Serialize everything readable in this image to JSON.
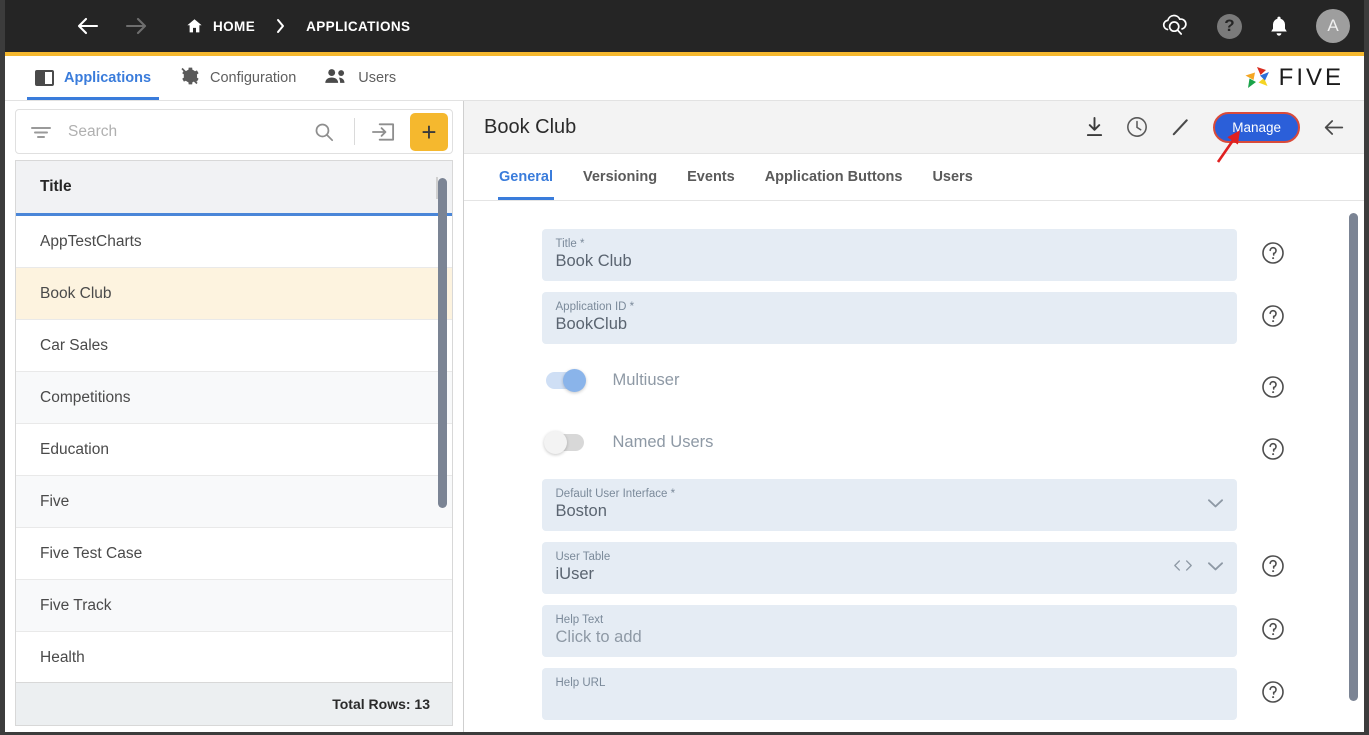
{
  "topbar": {
    "menu_icon": "hamburger-icon",
    "back_icon": "arrow-left-icon",
    "forward_icon": "arrow-right-icon",
    "home_icon": "home-icon",
    "breadcrumb": [
      "HOME",
      "APPLICATIONS"
    ],
    "separator": "chevron-right-icon",
    "right_icons": [
      "cloud-search-icon",
      "help-icon",
      "notifications-bell-icon"
    ],
    "avatar_initial": "A",
    "accent_strip_color": "#f5b82e",
    "background_color": "#252525"
  },
  "subnav": {
    "items": [
      {
        "label": "Applications",
        "icon": "applications-icon",
        "active": true
      },
      {
        "label": "Configuration",
        "icon": "configuration-gear-icon",
        "active": false
      },
      {
        "label": "Users",
        "icon": "users-icon",
        "active": false
      }
    ],
    "logo_text": "FIVE",
    "active_color": "#3a7cdb"
  },
  "sidebar": {
    "search": {
      "placeholder": "Search",
      "value": "",
      "filter_icon": "filter-icon",
      "search_icon": "search-icon",
      "import_icon": "import-icon",
      "add_label": "+",
      "add_color": "#f5b82e"
    },
    "grid": {
      "column_header": "Title",
      "rows": [
        "AppTestCharts",
        "Book Club",
        "Car Sales",
        "Competitions",
        "Education",
        "Five",
        "Five Test Case",
        "Five Track",
        "Health"
      ],
      "selected_row": "Book Club",
      "selected_color": "#fdf3df",
      "header_underline_color": "#4a86d8",
      "footer_label": "Total Rows: 13"
    }
  },
  "detail": {
    "title": "Book Club",
    "actions": [
      {
        "name": "download-icon",
        "label": ""
      },
      {
        "name": "history-clock-icon",
        "label": ""
      },
      {
        "name": "edit-pencil-icon",
        "label": ""
      }
    ],
    "manage_button": "Manage",
    "manage_color": "#2b5fd9",
    "back_icon": "arrow-left-icon",
    "annotation_arrow_color": "#e02020",
    "tabs": [
      {
        "label": "General",
        "active": true
      },
      {
        "label": "Versioning",
        "active": false
      },
      {
        "label": "Events",
        "active": false
      },
      {
        "label": "Application Buttons",
        "active": false
      },
      {
        "label": "Users",
        "active": false
      }
    ],
    "fields": [
      {
        "label": "Title",
        "required": true,
        "value": "Book Club",
        "type": "text",
        "help": true
      },
      {
        "label": "Application ID",
        "required": true,
        "value": "BookClub",
        "type": "text",
        "help": true
      },
      {
        "label": "Multiuser",
        "type": "toggle",
        "on": true,
        "help": true
      },
      {
        "label": "Named Users",
        "type": "toggle",
        "on": false,
        "help": true
      },
      {
        "label": "Default User Interface",
        "required": true,
        "value": "Boston",
        "type": "select",
        "help": false
      },
      {
        "label": "User Table",
        "required": false,
        "value": "iUser",
        "type": "select-code",
        "help": true
      },
      {
        "label": "Help Text",
        "required": false,
        "value": "Click to add",
        "placeholder_style": true,
        "type": "text",
        "help": true
      },
      {
        "label": "Help URL",
        "required": false,
        "value": "",
        "type": "textarea",
        "help": true
      }
    ]
  }
}
